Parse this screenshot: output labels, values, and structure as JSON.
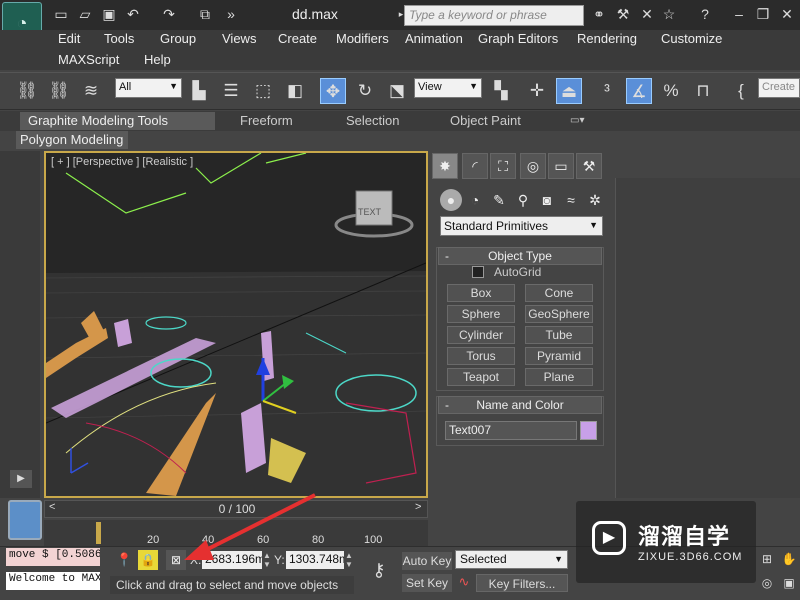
{
  "window": {
    "title": "dd.max",
    "search_placeholder": "Type a keyword or phrase"
  },
  "menu": [
    "Edit",
    "Tools",
    "Group",
    "Views",
    "Create",
    "Modifiers",
    "Animation",
    "Graph Editors",
    "Rendering",
    "Customize",
    "MAXScript",
    "Help"
  ],
  "toolbar": {
    "filter_select": "All",
    "ref_coord_select": "View",
    "named_selection": "Create"
  },
  "ribbon": {
    "tabs": [
      "Graphite Modeling Tools",
      "Freeform",
      "Selection",
      "Object Paint"
    ],
    "panel": "Polygon Modeling"
  },
  "viewport": {
    "label": "[ + ] [Perspective ] [Realistic ]",
    "viewcube_text": "TEXT"
  },
  "command_panel": {
    "primitive_type": "Standard Primitives",
    "object_type_title": "Object Type",
    "autogrid_label": "AutoGrid",
    "buttons": [
      "Box",
      "Cone",
      "Sphere",
      "GeoSphere",
      "Cylinder",
      "Tube",
      "Torus",
      "Pyramid",
      "Teapot",
      "Plane"
    ],
    "name_color_title": "Name and Color",
    "object_name": "Text007",
    "object_color": "#c8a0e8"
  },
  "timeline": {
    "frame_label": "0 / 100",
    "nav_left": "<",
    "nav_right": ">",
    "ticks": [
      "20",
      "40",
      "60",
      "80",
      "100"
    ]
  },
  "status": {
    "maxscript_line1": "move $ [0.5086",
    "maxscript_line2": "Welcome to MAX",
    "x_label": "X:",
    "x_value": "2683.196m",
    "y_label": "Y:",
    "y_value": "1303.748m",
    "prompt": "Click and drag to select and move objects",
    "auto_key": "Auto Key",
    "set_key": "Set Key",
    "selection_filter": "Selected",
    "key_filters": "Key Filters..."
  },
  "watermark": {
    "title": "溜溜自学",
    "subtitle": "ZIXUE.3D66.COM"
  },
  "colors": {
    "accent": "#c8a84a",
    "lock_active": "#e8d838",
    "arrow": "#e53030"
  }
}
